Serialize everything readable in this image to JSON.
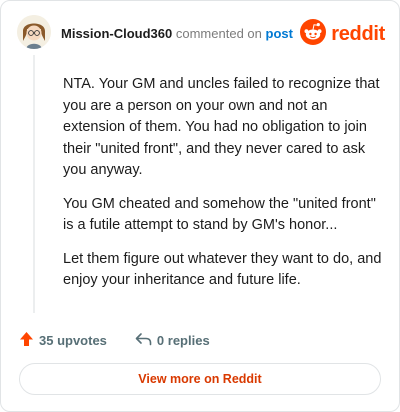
{
  "header": {
    "username": "Mission-Cloud360",
    "commented_on": "commented on",
    "post_label": "post",
    "brand": "reddit"
  },
  "comment": {
    "paragraphs": [
      "NTA. Your GM and uncles failed to recognize that you are a person on your own and not an extension of them. You had no obligation to join their \"united front\", and they never cared to ask you anyway.",
      "You GM cheated and somehow the \"united front\" is a futile attempt to stand by GM's honor...",
      "Let them figure out whatever they want to do, and enjoy your inheritance and future life."
    ]
  },
  "actions": {
    "upvotes": "35 upvotes",
    "replies": "0 replies"
  },
  "view_more_label": "View more on Reddit",
  "colors": {
    "brand": "#ff4500",
    "link": "#0079d3",
    "view_more": "#d93900",
    "upvote_arrow": "#ff4500"
  },
  "icons": [
    "avatar",
    "reddit-logo-icon",
    "upvote-arrow-icon",
    "reply-arrow-icon"
  ]
}
